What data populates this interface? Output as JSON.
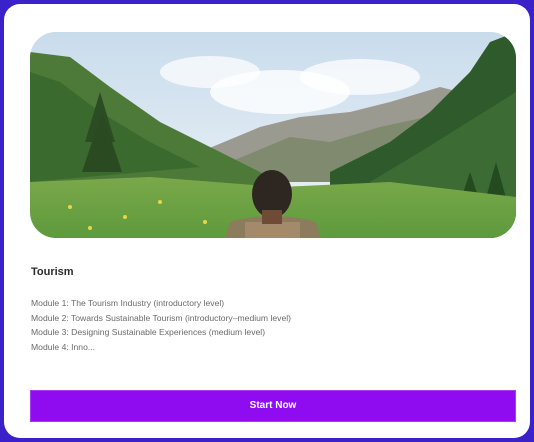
{
  "course": {
    "image_alt": "Mountain valley landscape with a hiker",
    "title": "Tourism",
    "modules": [
      "Module 1: The Tourism Industry (introductory level)",
      "Module 2: Towards Sustainable Tourism (introductory–medium level)",
      "Module 3: Designing Sustainable Experiences (medium level)",
      "Module 4: Inno..."
    ],
    "cta_label": "Start Now"
  },
  "colors": {
    "page_background": "#3b21c9",
    "card_background": "#ffffff",
    "cta_background": "#8f0cf1"
  }
}
